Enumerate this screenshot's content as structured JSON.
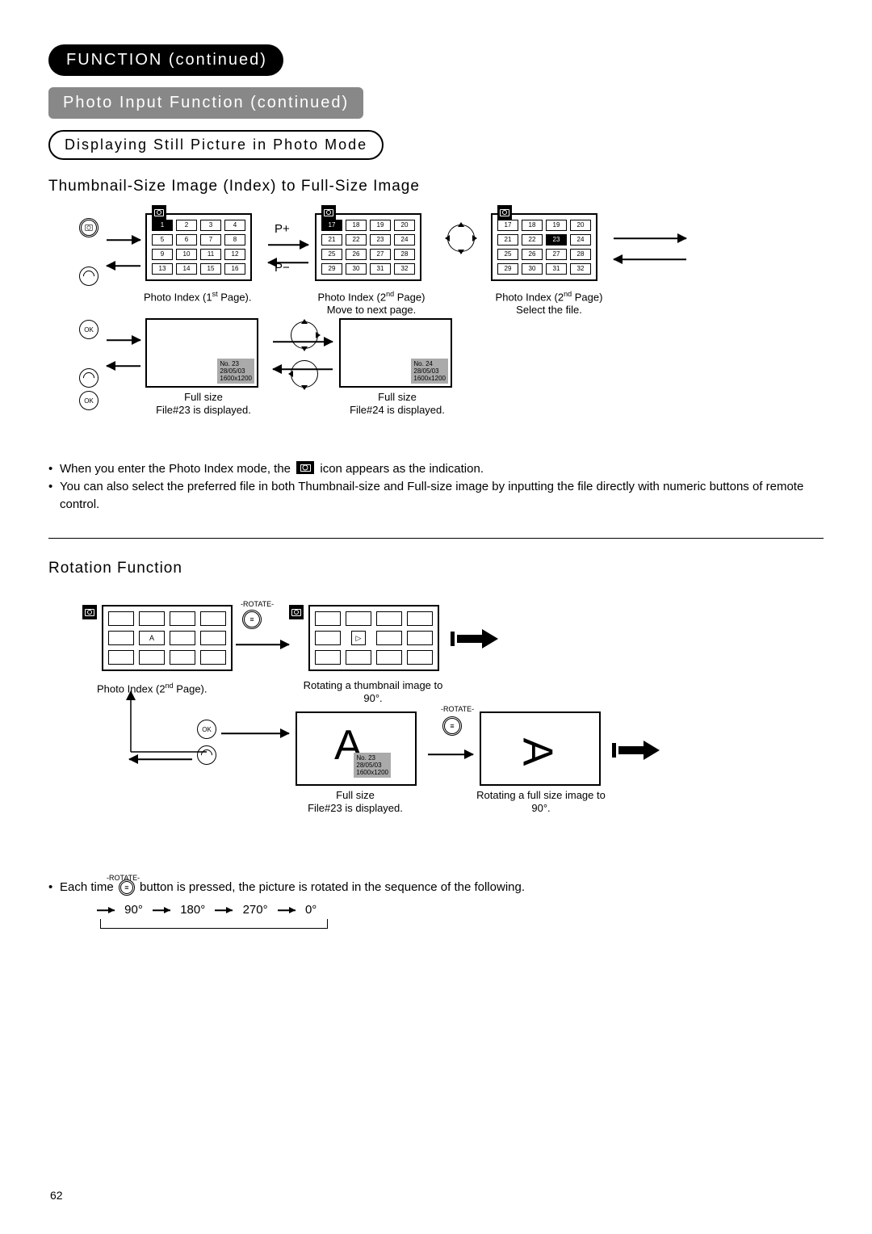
{
  "header": {
    "pill1": "FUNCTION (continued)",
    "pill2": "Photo Input Function (continued)",
    "box1": "Displaying Still Picture in Photo Mode"
  },
  "section1": {
    "title": "Thumbnail-Size Image (Index) to Full-Size Image",
    "p_plus": "P+",
    "p_minus": "P−",
    "ok": "OK",
    "cap1a": "Photo Index (1",
    "cap1b": " Page).",
    "cap2a": "Photo Index (2",
    "cap2b": " Page)",
    "cap2c": "Move to next page.",
    "cap3a": "Photo Index (2",
    "cap3b": " Page)",
    "cap3c": "Select the file.",
    "full1a": "Full size",
    "full1b": "File#23 is displayed.",
    "full2a": "Full size",
    "full2b": "File#24 is displayed.",
    "info_no23": "No. 23",
    "info_no24": "No. 24",
    "info_date": "28/05/03",
    "info_res": "1600x1200"
  },
  "grid1": [
    "1",
    "2",
    "3",
    "4",
    "5",
    "6",
    "7",
    "8",
    "9",
    "10",
    "11",
    "12",
    "13",
    "14",
    "15",
    "16"
  ],
  "grid2": [
    "17",
    "18",
    "19",
    "20",
    "21",
    "22",
    "23",
    "24",
    "25",
    "26",
    "27",
    "28",
    "29",
    "30",
    "31",
    "32"
  ],
  "bullets1": {
    "b1a": "When you enter the Photo Index mode, the ",
    "b1b": " icon appears as the indication.",
    "b2": "You can also select the preferred file in both Thumbnail-size and Full-size image by inputting the file directly with numeric buttons of remote control."
  },
  "section2": {
    "title": "Rotation Function",
    "rotate_lbl": "-ROTATE-",
    "capA1a": "Photo Index (2",
    "capA1b": " Page).",
    "capB": "Rotating a thumbnail image to 90°.",
    "capC1": "Full size",
    "capC2": "File#23 is displayed.",
    "capD": "Rotating a full size image to 90°.",
    "letterA": "A",
    "info_no23": "No. 23",
    "info_date": "28/05/03",
    "info_res": "1600x1200",
    "ok": "OK"
  },
  "bullets2": {
    "b1a": "Each time ",
    "b1b": " button is pressed, the picture is rotated in the sequence of the following."
  },
  "rotseq": [
    "90°",
    "180°",
    "270°",
    "0°"
  ],
  "page": "62"
}
